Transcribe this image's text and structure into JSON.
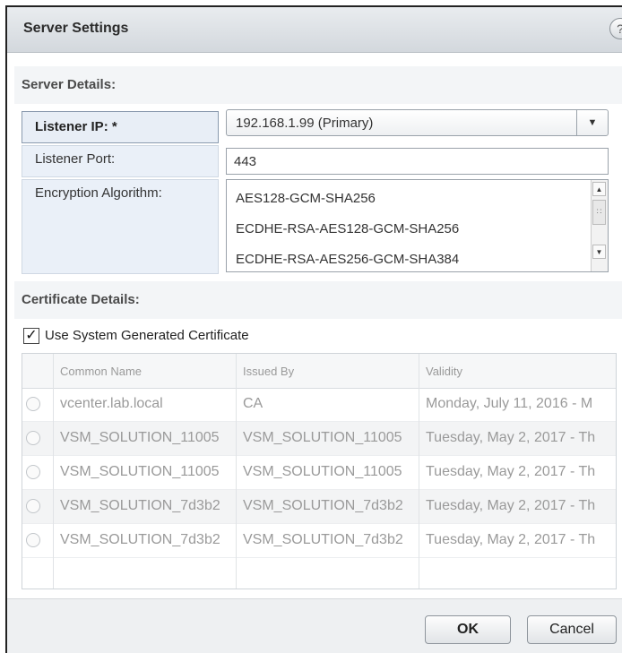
{
  "dialog": {
    "title": "Server Settings",
    "help_glyph": "?"
  },
  "server_details": {
    "heading": "Server Details:",
    "listener_ip_label": "Listener IP: *",
    "listener_ip_value": "192.168.1.99 (Primary)",
    "listener_port_label": "Listener Port:",
    "listener_port_value": "443",
    "encryption_label": "Encryption Algorithm:",
    "encryption_options": [
      "AES128-GCM-SHA256",
      "ECDHE-RSA-AES128-GCM-SHA256",
      "ECDHE-RSA-AES256-GCM-SHA384"
    ]
  },
  "certificate_details": {
    "heading": "Certificate Details:",
    "use_system_cert_label": "Use System Generated Certificate",
    "use_system_cert_checked": true,
    "columns": [
      "Common Name",
      "Issued By",
      "Validity"
    ],
    "rows": [
      [
        "vcenter.lab.local",
        "CA",
        "Monday, July 11, 2016 - M"
      ],
      [
        "VSM_SOLUTION_11005",
        "VSM_SOLUTION_11005",
        "Tuesday, May 2, 2017 - Th"
      ],
      [
        "VSM_SOLUTION_11005",
        "VSM_SOLUTION_11005",
        "Tuesday, May 2, 2017 - Th"
      ],
      [
        "VSM_SOLUTION_7d3b2",
        "VSM_SOLUTION_7d3b2",
        "Tuesday, May 2, 2017 - Th"
      ],
      [
        "VSM_SOLUTION_7d3b2",
        "VSM_SOLUTION_7d3b2",
        "Tuesday, May 2, 2017 - Th"
      ]
    ]
  },
  "footer": {
    "ok_label": "OK",
    "cancel_label": "Cancel"
  }
}
